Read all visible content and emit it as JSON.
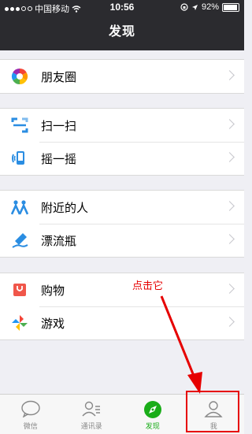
{
  "status_bar": {
    "carrier": "中国移动",
    "time": "10:56",
    "battery": "92%",
    "battery_level": 0.92
  },
  "header": {
    "title": "发现"
  },
  "groups": [
    {
      "items": [
        {
          "label": "朋友圈",
          "icon": "moments-icon"
        }
      ]
    },
    {
      "items": [
        {
          "label": "扫一扫",
          "icon": "scan-icon"
        },
        {
          "label": "摇一摇",
          "icon": "shake-icon"
        }
      ]
    },
    {
      "items": [
        {
          "label": "附近的人",
          "icon": "people-nearby-icon"
        },
        {
          "label": "漂流瓶",
          "icon": "drift-bottle-icon"
        }
      ]
    },
    {
      "items": [
        {
          "label": "购物",
          "icon": "shopping-icon"
        },
        {
          "label": "游戏",
          "icon": "games-icon"
        }
      ]
    }
  ],
  "annotation": {
    "text": "点击它",
    "color": "#e60000"
  },
  "tabbar": {
    "tabs": [
      {
        "label": "微信",
        "icon": "chat-bubble-icon",
        "active": false
      },
      {
        "label": "通讯录",
        "icon": "contacts-icon",
        "active": false
      },
      {
        "label": "发现",
        "icon": "discover-icon",
        "active": true
      },
      {
        "label": "我",
        "icon": "me-icon",
        "active": false
      }
    ]
  },
  "colors": {
    "header_bg": "#2b2b2f",
    "accent_green": "#1aad19",
    "background": "#efeff4"
  }
}
